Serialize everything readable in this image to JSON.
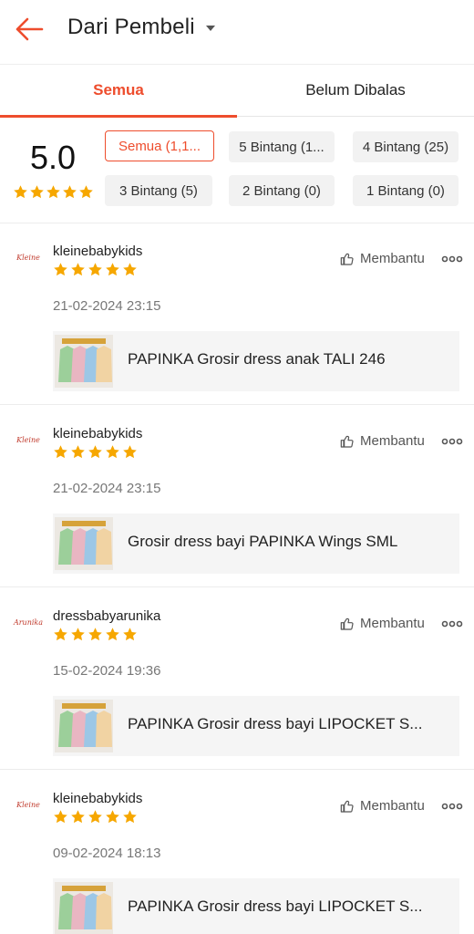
{
  "header": {
    "title": "Dari Pembeli"
  },
  "tabs": [
    {
      "label": "Semua",
      "active": true
    },
    {
      "label": "Belum Dibalas",
      "active": false
    }
  ],
  "summary": {
    "score": "5.0",
    "stars": 5,
    "filters": [
      {
        "label": "Semua (1,1...",
        "active": true
      },
      {
        "label": "5 Bintang (1...",
        "active": false
      },
      {
        "label": "4 Bintang (25)",
        "active": false
      },
      {
        "label": "3 Bintang (5)",
        "active": false
      },
      {
        "label": "2 Bintang (0)",
        "active": false
      },
      {
        "label": "1 Bintang (0)",
        "active": false
      }
    ]
  },
  "helpful_label": "Membantu",
  "colors": {
    "accent": "#ee4d2d",
    "star": "#f6a700"
  },
  "reviews": [
    {
      "username": "kleinebabykids",
      "avatar_text": "Kleine",
      "rating": 5,
      "date": "21-02-2024 23:15",
      "product": "PAPINKA Grosir dress anak TALI 246"
    },
    {
      "username": "kleinebabykids",
      "avatar_text": "Kleine",
      "rating": 5,
      "date": "21-02-2024 23:15",
      "product": "Grosir dress bayi PAPINKA Wings SML"
    },
    {
      "username": "dressbabyarunika",
      "avatar_text": "Arunika",
      "rating": 5,
      "date": "15-02-2024 19:36",
      "product": "PAPINKA Grosir dress bayi LIPOCKET S..."
    },
    {
      "username": "kleinebabykids",
      "avatar_text": "Kleine",
      "rating": 5,
      "date": "09-02-2024 18:13",
      "product": "PAPINKA Grosir dress bayi LIPOCKET S..."
    }
  ]
}
